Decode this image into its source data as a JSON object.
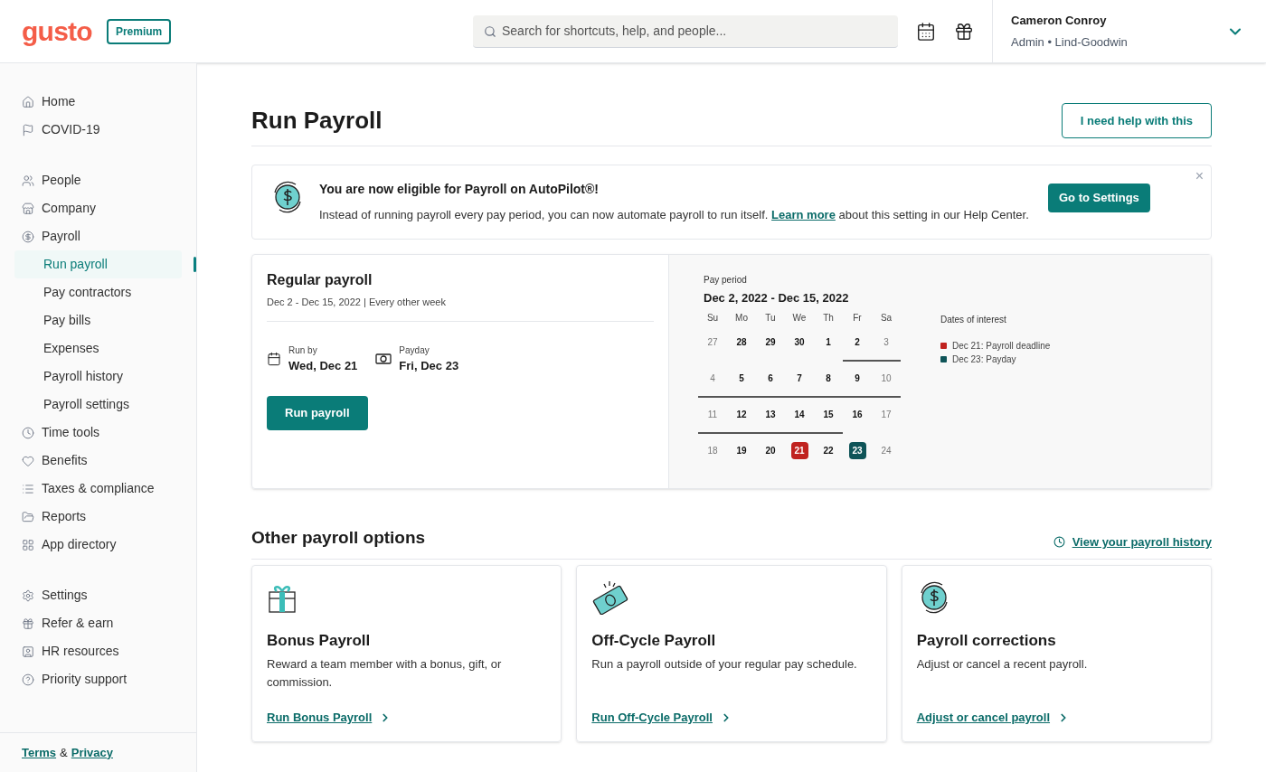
{
  "header": {
    "logo": "gusto",
    "plan_badge": "Premium",
    "search": {
      "placeholder": "Search for shortcuts, help, and people..."
    },
    "user": {
      "name": "Cameron Conroy",
      "role": "Admin • Lind-Goodwin"
    }
  },
  "sidebar": {
    "groups": [
      {
        "items": [
          {
            "label": "Home",
            "selected": false
          },
          {
            "label": "COVID-19",
            "selected": false
          }
        ]
      },
      {
        "items": [
          {
            "label": "People",
            "selected": false
          },
          {
            "label": "Company",
            "selected": false
          },
          {
            "label": "Payroll",
            "selected": false,
            "children": [
              {
                "label": "Run payroll",
                "selected": true
              },
              {
                "label": "Pay contractors",
                "selected": false
              },
              {
                "label": "Pay bills",
                "selected": false
              },
              {
                "label": "Expenses",
                "selected": false
              },
              {
                "label": "Payroll history",
                "selected": false
              },
              {
                "label": "Payroll settings",
                "selected": false
              }
            ]
          },
          {
            "label": "Time tools",
            "selected": false
          },
          {
            "label": "Benefits",
            "selected": false
          },
          {
            "label": "Taxes & compliance",
            "selected": false
          },
          {
            "label": "Reports",
            "selected": false
          },
          {
            "label": "App directory",
            "selected": false
          }
        ]
      },
      {
        "items": [
          {
            "label": "Settings",
            "selected": false
          },
          {
            "label": "Refer & earn",
            "selected": false
          },
          {
            "label": "HR resources",
            "selected": false
          },
          {
            "label": "Priority support",
            "selected": false
          }
        ]
      }
    ],
    "footer": {
      "terms": "Terms",
      "separator": "&",
      "privacy": "Privacy"
    }
  },
  "page": {
    "title": "Run Payroll",
    "help_button": "I need help with this"
  },
  "banner": {
    "title": "You are now eligible for Payroll on AutoPilot®!",
    "text_before": "Instead of running payroll every pay period, you can now automate payroll to run itself.",
    "link": "Learn more",
    "text_after": "about this setting in our Help Center.",
    "button": "Go to Settings",
    "close": "×"
  },
  "regular_payroll": {
    "title": "Regular payroll",
    "subtitle": "Dec 2 - Dec 15, 2022 | Every other week",
    "run_by": {
      "label": "Run by",
      "value": "Wed, Dec 21"
    },
    "payday": {
      "label": "Payday",
      "value": "Fri, Dec 23"
    },
    "button": "Run payroll"
  },
  "calendar": {
    "label": "Pay period",
    "range": "Dec 2, 2022 - Dec 15, 2022",
    "weekdays": [
      "Su",
      "Mo",
      "Tu",
      "We",
      "Th",
      "Fr",
      "Sa"
    ],
    "weeks": [
      [
        {
          "day": "27",
          "dim": true,
          "in_period": false
        },
        {
          "day": "28",
          "dim": false,
          "in_period": false
        },
        {
          "day": "29",
          "dim": false,
          "in_period": false
        },
        {
          "day": "30",
          "dim": false,
          "in_period": false
        },
        {
          "day": "1",
          "dim": false,
          "in_period": false
        },
        {
          "day": "2",
          "dim": false,
          "in_period": true
        },
        {
          "day": "3",
          "dim": true,
          "in_period": true
        }
      ],
      [
        {
          "day": "4",
          "dim": true,
          "in_period": true
        },
        {
          "day": "5",
          "dim": false,
          "in_period": true
        },
        {
          "day": "6",
          "dim": false,
          "in_period": true
        },
        {
          "day": "7",
          "dim": false,
          "in_period": true
        },
        {
          "day": "8",
          "dim": false,
          "in_period": true
        },
        {
          "day": "9",
          "dim": false,
          "in_period": true
        },
        {
          "day": "10",
          "dim": true,
          "in_period": true
        }
      ],
      [
        {
          "day": "11",
          "dim": true,
          "in_period": true
        },
        {
          "day": "12",
          "dim": false,
          "in_period": true
        },
        {
          "day": "13",
          "dim": false,
          "in_period": true
        },
        {
          "day": "14",
          "dim": false,
          "in_period": true
        },
        {
          "day": "15",
          "dim": false,
          "in_period": true
        },
        {
          "day": "16",
          "dim": false,
          "in_period": false
        },
        {
          "day": "17",
          "dim": true,
          "in_period": false
        }
      ],
      [
        {
          "day": "18",
          "dim": true,
          "in_period": false
        },
        {
          "day": "19",
          "dim": false,
          "in_period": false
        },
        {
          "day": "20",
          "dim": false,
          "in_period": false
        },
        {
          "day": "21",
          "in_period": false,
          "color": "#c0221f"
        },
        {
          "day": "22",
          "dim": false,
          "in_period": false
        },
        {
          "day": "23",
          "in_period": false,
          "color": "#0f5458"
        },
        {
          "day": "24",
          "dim": true,
          "in_period": false
        }
      ]
    ],
    "legend_title": "Dates of interest",
    "legend": [
      {
        "text": "Dec 21: Payroll deadline",
        "color": "#c0221f"
      },
      {
        "text": "Dec 23: Payday",
        "color": "#0f5458"
      }
    ]
  },
  "other_options": {
    "title": "Other payroll options",
    "history_link": "View your payroll history",
    "cards": [
      {
        "kind": "gift",
        "title": "Bonus Payroll",
        "text": "Reward a team member with a bonus, gift, or commission.",
        "link": "Run Bonus Payroll"
      },
      {
        "kind": "cash",
        "title": "Off-Cycle Payroll",
        "text": "Run a payroll outside of your regular pay schedule.",
        "link": "Run Off-Cycle Payroll"
      },
      {
        "kind": "cycle",
        "title": "Payroll corrections",
        "text": "Adjust or cancel a recent payroll.",
        "link": "Adjust or cancel payroll"
      }
    ]
  }
}
